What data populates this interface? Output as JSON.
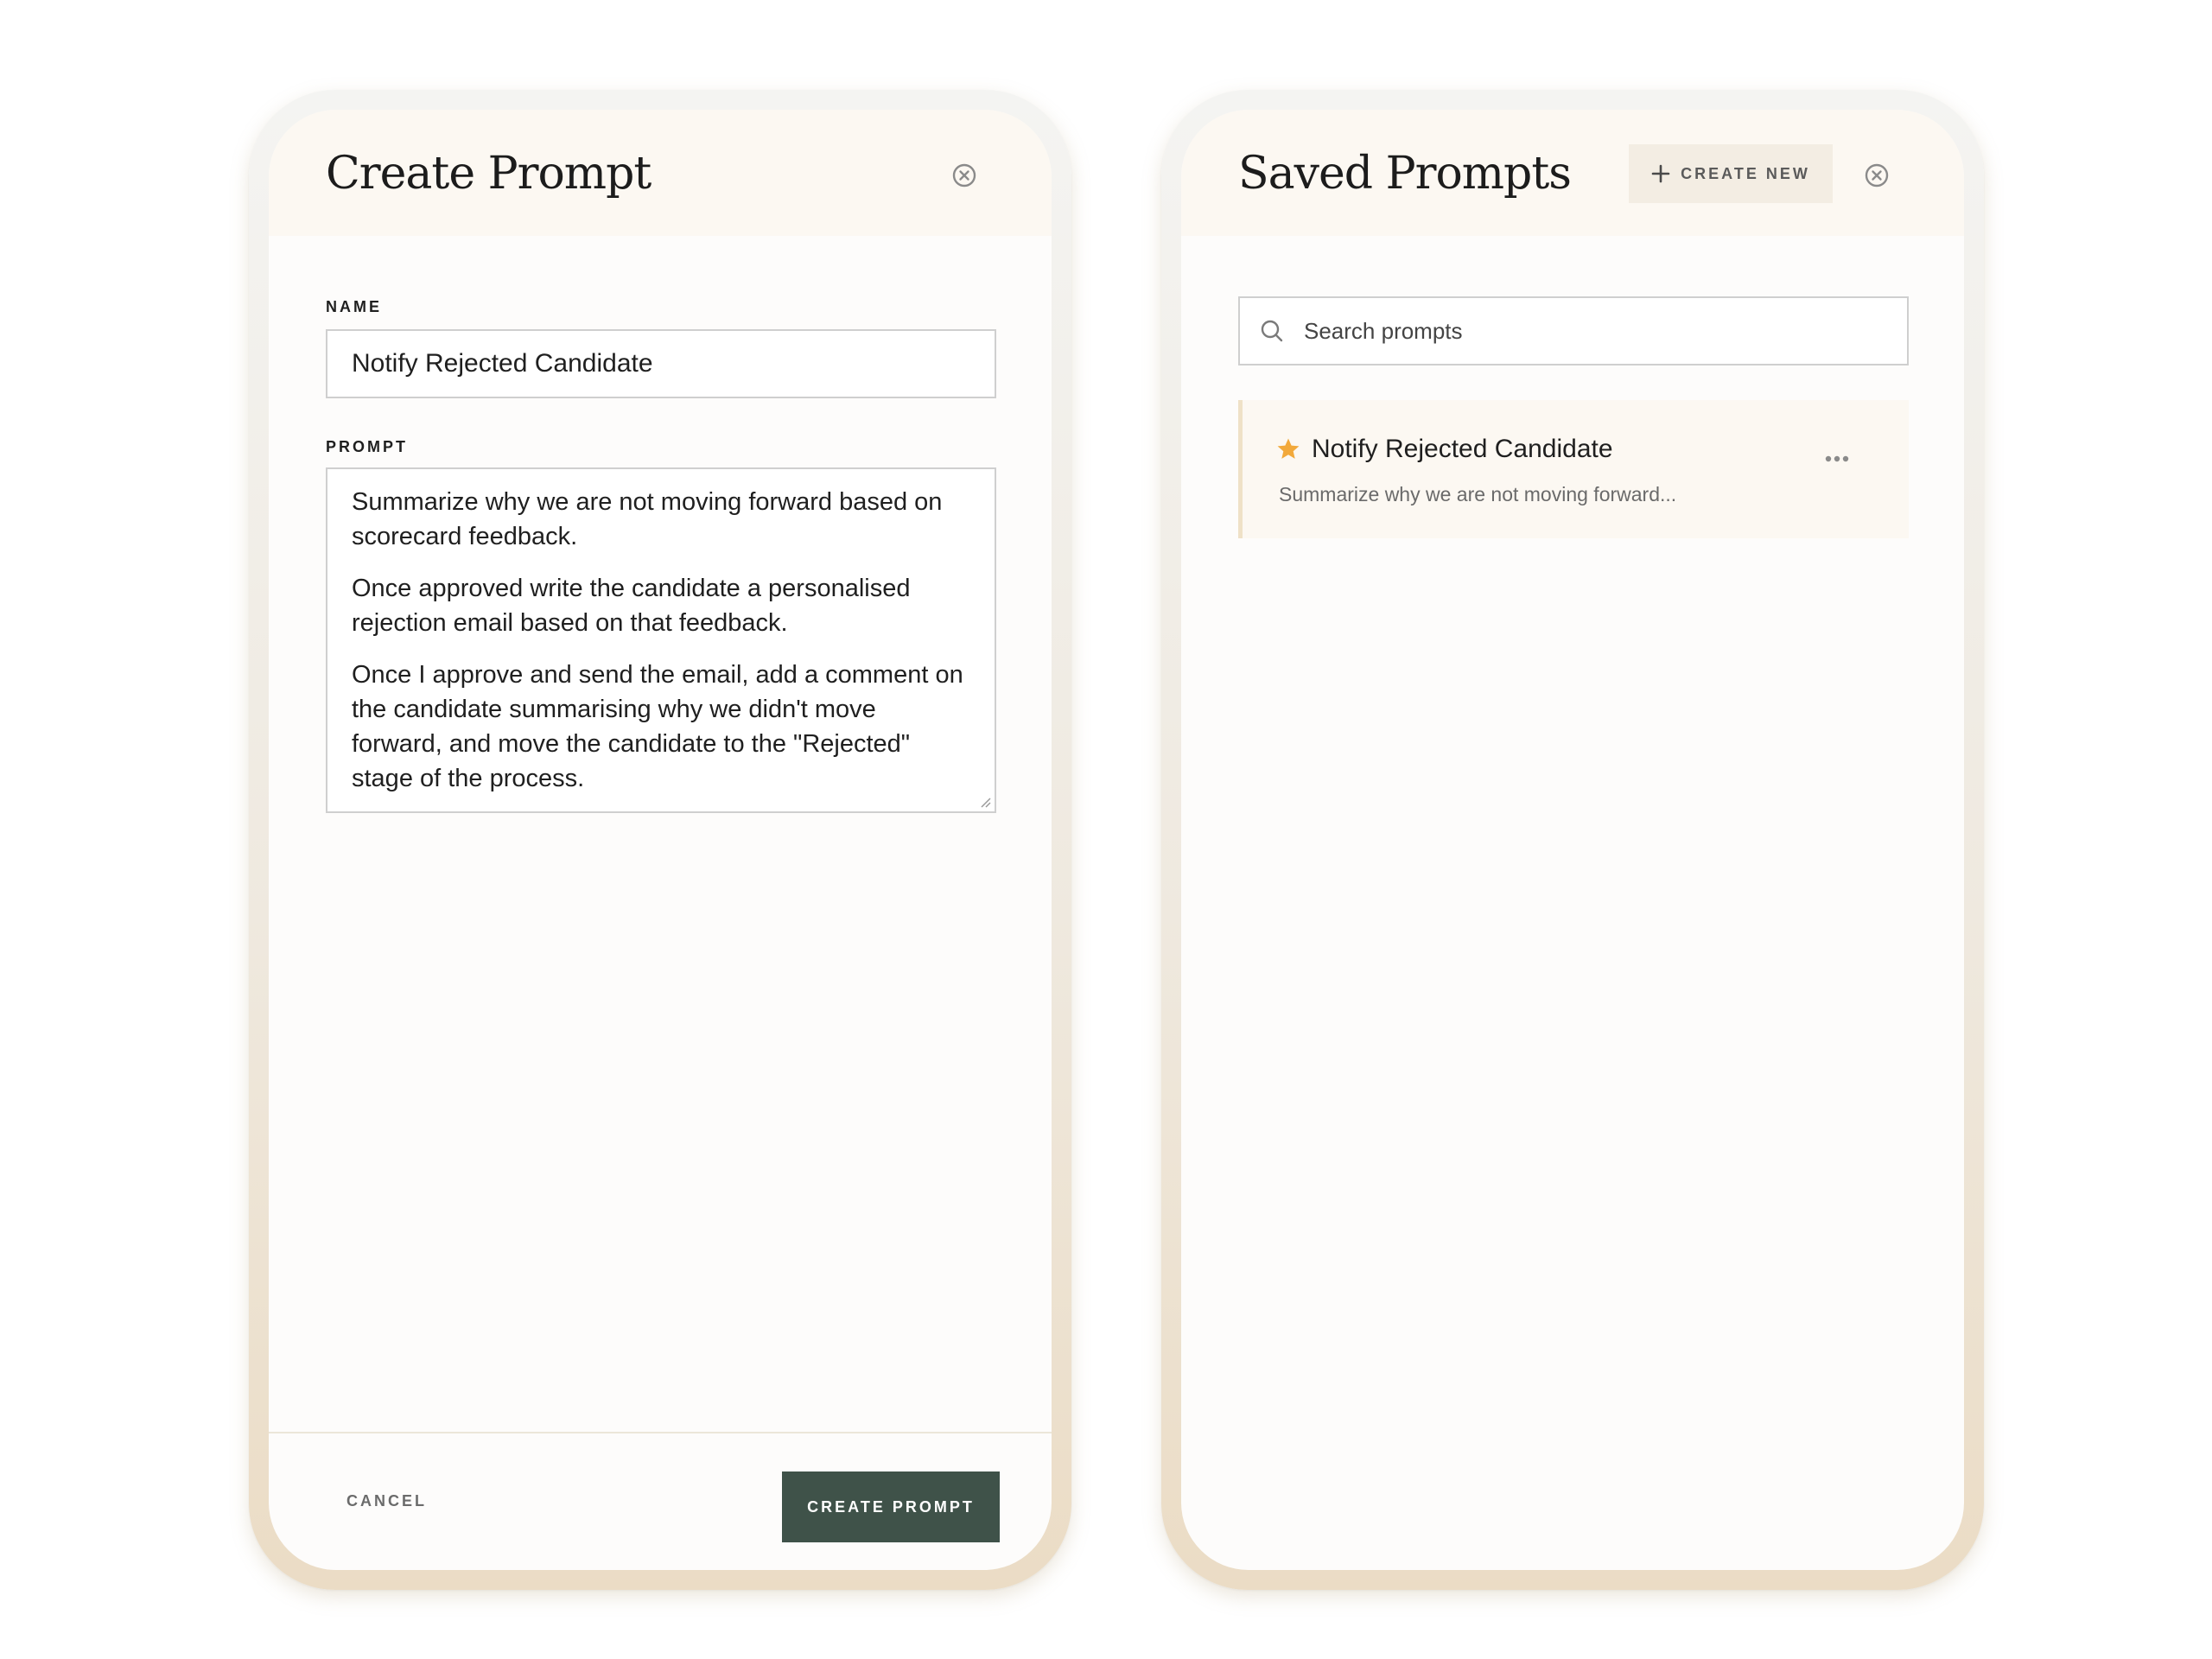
{
  "create_prompt": {
    "title": "Create Prompt",
    "name_label": "NAME",
    "name_value": "Notify Rejected Candidate",
    "prompt_label": "PROMPT",
    "prompt_paragraphs": [
      "Summarize why we are not moving forward based on scorecard feedback.",
      "Once approved write the candidate a personalised rejection email based on that feedback.",
      "Once I approve and send the email, add a comment on the candidate summarising why we didn't move forward, and move the candidate to the \"Rejected\" stage of the process."
    ],
    "cancel_label": "CANCEL",
    "submit_label": "CREATE PROMPT"
  },
  "saved_prompts": {
    "title": "Saved Prompts",
    "create_new_label": "CREATE NEW",
    "search_placeholder": "Search prompts",
    "items": [
      {
        "title": "Notify Rejected Candidate",
        "preview": "Summarize why we are not moving forward...",
        "starred": true
      }
    ]
  },
  "icons": {
    "close": "close-circle-icon",
    "plus": "plus-icon",
    "search": "search-icon",
    "star": "star-icon",
    "more": "more-horizontal-icon"
  },
  "colors": {
    "primary_button": "#3f5249",
    "header_bg": "#fcf8f2",
    "star": "#f2a93b",
    "card_accent": "#efe1c7"
  }
}
